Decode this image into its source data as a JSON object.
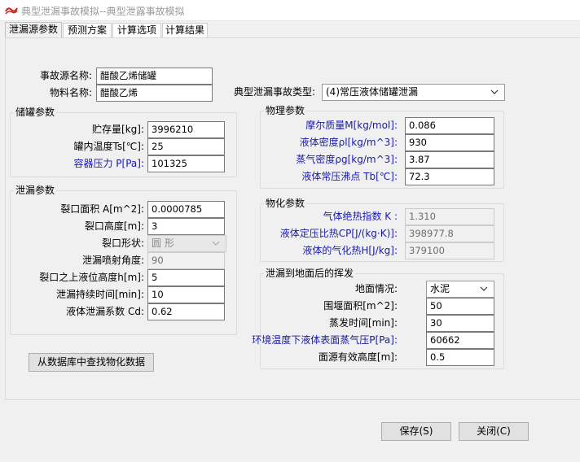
{
  "window": {
    "title": "典型泄漏事故模拟--典型泄露事故模拟",
    "icon": "app-logo-icon"
  },
  "tabs": [
    {
      "label": "泄漏源参数"
    },
    {
      "label": "预测方案"
    },
    {
      "label": "计算选项"
    },
    {
      "label": "计算结果"
    }
  ],
  "source": {
    "name_label": "事故源名称:",
    "name_value": "醋酸乙烯储罐",
    "material_label": "物料名称:",
    "material_value": "醋酸乙烯",
    "type_label": "典型泄漏事故类型:",
    "type_value": "(4)常压液体储罐泄漏"
  },
  "tank": {
    "title": "储罐参数",
    "storage_label": "贮存量[kg]:",
    "storage_value": "3996210",
    "temp_label": "罐内温度Ts[℃]:",
    "temp_value": "25",
    "pressure_label": "容器压力 P[Pa]:",
    "pressure_value": "101325"
  },
  "leak": {
    "title": "泄漏参数",
    "area_label": "裂口面积 A[m^2]:",
    "area_value": "0.0000785",
    "height_label": "裂口高度[m]:",
    "height_value": "3",
    "shape_label": "裂口形状:",
    "shape_value": "圆  形",
    "angle_label": "泄漏喷射角度:",
    "angle_value": "90",
    "level_label": "裂口之上液位高度h[m]:",
    "level_value": "5",
    "duration_label": "泄漏持续时间[min]:",
    "duration_value": "10",
    "coef_label": "液体泄漏系数  Cd:",
    "coef_value": "0.62"
  },
  "physical": {
    "title": "物理参数",
    "molar_label": "摩尔质量M[kg/mol]:",
    "molar_value": "0.086",
    "liquid_density_label": "液体密度ρl[kg/m^3]:",
    "liquid_density_value": "930",
    "vapor_density_label": "蒸气密度ρg[kg/m^3]:",
    "vapor_density_value": "3.87",
    "boiling_label": "液体常压沸点 Tb[℃]:",
    "boiling_value": "72.3"
  },
  "chemical": {
    "title": "物化参数",
    "k_label": "气体绝热指数  K :",
    "k_value": "1.310",
    "cp_label": "液体定压比热CP[J/(kg·K)]:",
    "cp_value": "398977.8",
    "heat_label": "液体的气化热H[J/kg]:",
    "heat_value": "379100"
  },
  "evap": {
    "title": "泄漏到地面后的挥发",
    "ground_label": "地面情况:",
    "ground_value": "水泥",
    "area_label": "围堰面积[m^2]:",
    "area_value": "50",
    "time_label": "蒸发时间[min]:",
    "time_value": "30",
    "vp_label": "环境温度下液体表面蒸气压P[Pa]:",
    "vp_value": "60662",
    "height_label": "面源有效高度[m]:",
    "height_value": "0.5"
  },
  "buttons": {
    "lookup": "从数据库中查找物化数据",
    "save": "保存(S)",
    "close": "关闭(C)"
  },
  "colors": {
    "blue_label": "#1a1aaa",
    "panel_bg": "#f0f0f0",
    "disabled_text": "#6d6d6d"
  }
}
